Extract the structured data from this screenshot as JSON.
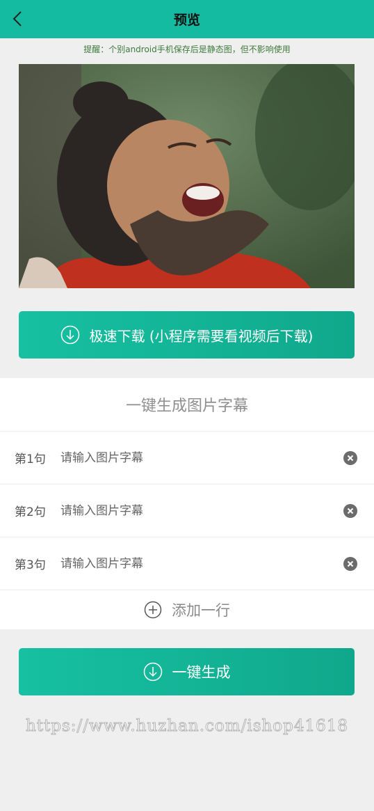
{
  "header": {
    "title": "预览"
  },
  "notice": "提醒：个别android手机保存后是静态图，但不影响使用",
  "download_button": {
    "label": "极速下载 (小程序需要看视频后下载)"
  },
  "caption_panel": {
    "title": "一键生成图片字幕",
    "rows": [
      {
        "label": "第1句",
        "placeholder": "请输入图片字幕",
        "value": ""
      },
      {
        "label": "第2句",
        "placeholder": "请输入图片字幕",
        "value": ""
      },
      {
        "label": "第3句",
        "placeholder": "请输入图片字幕",
        "value": ""
      }
    ],
    "add_row_label": "添加一行"
  },
  "generate_button": {
    "label": "一键生成"
  },
  "watermark": "https://www.huzhan.com/ishop41618",
  "colors": {
    "accent": "#14bba0",
    "notice": "#3e7a3c"
  },
  "icons": [
    "back-arrow-icon",
    "download-icon",
    "clear-icon",
    "add-circle-icon"
  ]
}
